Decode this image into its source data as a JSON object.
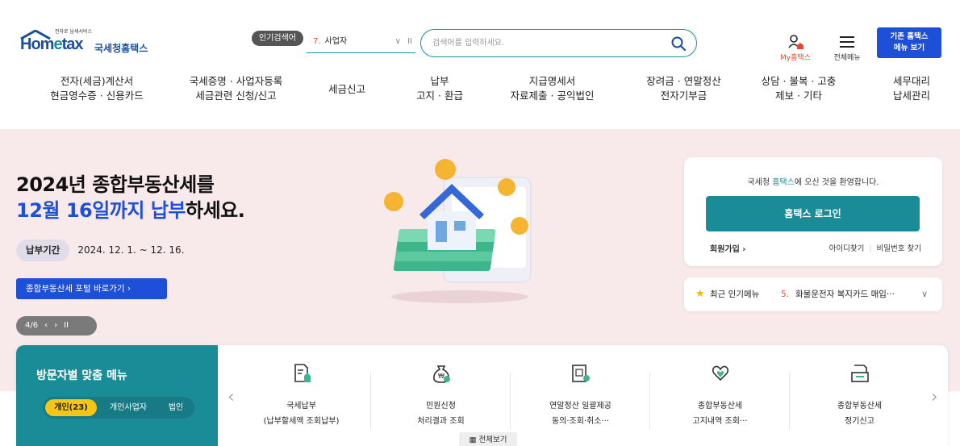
{
  "header": {
    "logo_sub": "전자로 납세서비스",
    "logo_brand_a": "Hom",
    "logo_brand_b": "e",
    "logo_brand_c": "tax",
    "logo_kname": "국세청홈택스",
    "popular_badge": "인기검색어",
    "popular_num": "7.",
    "popular_value": "사업자",
    "search_placeholder": "검색어를 입력하세요.",
    "my_hometax": "My홈택스",
    "all_menu": "전체메뉴",
    "old_site_line1": "기존 홈택스",
    "old_site_line2": "메뉴 보기"
  },
  "gnb": [
    {
      "l1": "전자(세금)계산서",
      "l2": "현금영수증 · 신용카드"
    },
    {
      "l1": "국세증명 · 사업자등록",
      "l2": "세금관련 신청/신고"
    },
    {
      "l1": "세금신고",
      "l2": ""
    },
    {
      "l1": "납부",
      "l2": "고지 · 환급"
    },
    {
      "l1": "지급명세서",
      "l2": "자료제출 · 공익법인"
    },
    {
      "l1": "장려금 · 연말정산",
      "l2": "전자기부금"
    },
    {
      "l1": "상담 · 불복 · 고충",
      "l2": "제보 · 기타"
    },
    {
      "l1": "세무대리",
      "l2": "납세관리"
    }
  ],
  "hero": {
    "title_line1": "2024년 종합부동산세를",
    "title_blue": "12월 16일까지 납부",
    "title_rest": "하세요.",
    "period_tag": "납부기간",
    "period_value": "2024. 12. 1. ~ 12. 16.",
    "portal_button": "종합부동산세 포털 바로가기 ›",
    "pager_count": "4/6",
    "pager_prev": "‹",
    "pager_next": "›",
    "pager_pause": "II"
  },
  "login": {
    "welcome_a": "국세청 ",
    "welcome_b": "홈택스",
    "welcome_c": "에 오신 것을 환영합니다.",
    "login_button": "홈택스 로그인",
    "join": "회원가입 ›",
    "find_id": "아이디찾기",
    "find_pw": "비밀번호 찾기"
  },
  "popular_menu": {
    "label": "최근 인기메뉴",
    "num": "5.",
    "value": "화물운전자 복지카드 매입···"
  },
  "visitor": {
    "title": "방문자별 맞춤 메뉴",
    "tabs": [
      "개인(23)",
      "개인사업자",
      "법인"
    ]
  },
  "services": [
    {
      "l1": "국세납부",
      "l2": "(납부할세액 조회납부)",
      "icon": "document-upload-icon"
    },
    {
      "l1": "민원신청",
      "l2": "처리결과 조회",
      "icon": "money-bag-icon"
    },
    {
      "l1": "연말정산 일괄제공",
      "l2": "동의·조회·취소···",
      "icon": "certificate-icon"
    },
    {
      "l1": "종합부동산세",
      "l2": "고지내역 조회···",
      "icon": "heart-hands-icon"
    },
    {
      "l1": "종합부동산세",
      "l2": "정기신고",
      "icon": "document-edit-icon"
    }
  ],
  "view_all": "전체보기",
  "colors": {
    "brand_blue": "#1d4fd8",
    "teal": "#1a8c97",
    "hero_bg": "#f8e9ea",
    "accent_red": "#e84b2b",
    "yellow": "#f5c518"
  }
}
